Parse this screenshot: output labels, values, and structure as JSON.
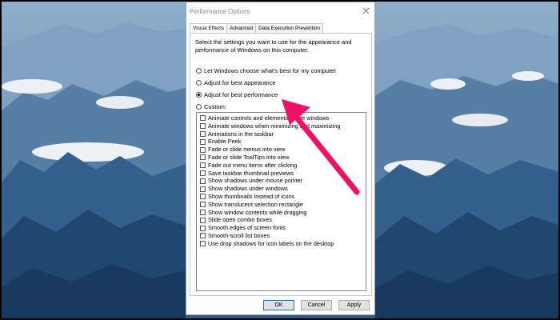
{
  "dialog": {
    "title": "Performance Options",
    "tabs": [
      {
        "label": "Visual Effects",
        "active": true
      },
      {
        "label": "Advanced",
        "active": false
      },
      {
        "label": "Data Execution Prevention",
        "active": false
      }
    ],
    "description": "Select the settings you want to use for the appearance and performance of Windows on this computer.",
    "radio_options": [
      {
        "label": "Let Windows choose what's best for my computer",
        "selected": false
      },
      {
        "label": "Adjust for best appearance",
        "selected": false
      },
      {
        "label": "Adjust for best performance",
        "selected": true
      },
      {
        "label": "Custom:",
        "selected": false
      }
    ],
    "effects": [
      {
        "label": "Animate controls and elements inside windows",
        "checked": false
      },
      {
        "label": "Animate windows when minimizing and maximizing",
        "checked": false
      },
      {
        "label": "Animations in the taskbar",
        "checked": false
      },
      {
        "label": "Enable Peek",
        "checked": false
      },
      {
        "label": "Fade or slide menus into view",
        "checked": false
      },
      {
        "label": "Fade or slide ToolTips into view",
        "checked": false
      },
      {
        "label": "Fade out menu items after clicking",
        "checked": false
      },
      {
        "label": "Save taskbar thumbnail previews",
        "checked": false
      },
      {
        "label": "Show shadows under mouse pointer",
        "checked": false
      },
      {
        "label": "Show shadows under windows",
        "checked": false
      },
      {
        "label": "Show thumbnails instead of icons",
        "checked": false
      },
      {
        "label": "Show translucent selection rectangle",
        "checked": false
      },
      {
        "label": "Show window contents while dragging",
        "checked": false
      },
      {
        "label": "Slide open combo boxes",
        "checked": false
      },
      {
        "label": "Smooth edges of screen fonts",
        "checked": false
      },
      {
        "label": "Smooth-scroll list boxes",
        "checked": false
      },
      {
        "label": "Use drop shadows for icon labels on the desktop",
        "checked": false
      }
    ],
    "buttons": {
      "ok": "OK",
      "cancel": "Cancel",
      "apply": "Apply"
    }
  },
  "icons": {
    "close": "close-icon",
    "annotation": "arrow-icon"
  },
  "colors": {
    "arrow": "#ee1166",
    "sky": "#6d94b6",
    "mountain_dark": "#1f4268",
    "cloud": "#f2f4f6"
  }
}
